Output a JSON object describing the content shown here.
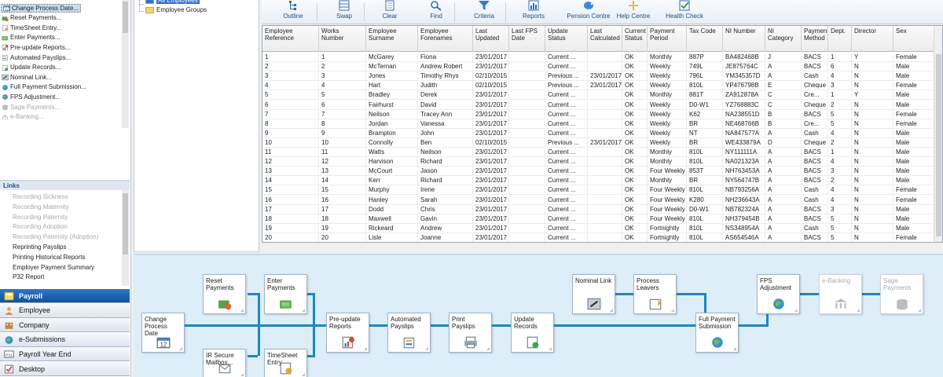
{
  "tasks": [
    {
      "label": "Change Process Date...",
      "icon": "calendar-icon",
      "selected": true,
      "enabled": true
    },
    {
      "label": "Reset Payments...",
      "icon": "reset-icon",
      "selected": false,
      "enabled": true
    },
    {
      "label": "TimeSheet Entry...",
      "icon": "timesheet-icon",
      "selected": false,
      "enabled": true
    },
    {
      "label": "Enter Payments...",
      "icon": "payments-icon",
      "selected": false,
      "enabled": true
    },
    {
      "label": "Pre-update Reports...",
      "icon": "report-icon",
      "selected": false,
      "enabled": true
    },
    {
      "label": "Automated Payslips...",
      "icon": "payslip-icon",
      "selected": false,
      "enabled": true
    },
    {
      "label": "Update Records...",
      "icon": "update-icon",
      "selected": false,
      "enabled": true
    },
    {
      "label": "Nominal Link...",
      "icon": "nominal-icon",
      "selected": false,
      "enabled": true
    },
    {
      "label": "Full Payment Submission...",
      "icon": "globe-icon",
      "selected": false,
      "enabled": true
    },
    {
      "label": "FPS Adjustment...",
      "icon": "globe-icon",
      "selected": false,
      "enabled": true
    },
    {
      "label": "Sage Payments...",
      "icon": "sage-icon",
      "selected": false,
      "enabled": false
    },
    {
      "label": "e-Banking...",
      "icon": "bank-icon",
      "selected": false,
      "enabled": false
    }
  ],
  "links": {
    "title": "Links",
    "items": [
      {
        "label": "Recording Sickness",
        "enabled": false
      },
      {
        "label": "Recording Maternity",
        "enabled": false
      },
      {
        "label": "Recording Paternity",
        "enabled": false
      },
      {
        "label": "Recording Adoption",
        "enabled": false
      },
      {
        "label": "Recording Paternity (Adoption)",
        "enabled": false
      },
      {
        "label": "Reprinting Payslips",
        "enabled": true
      },
      {
        "label": "Printing Historical Reports",
        "enabled": true
      },
      {
        "label": "Employer Payment Summary",
        "enabled": true
      },
      {
        "label": "P32 Report",
        "enabled": true
      }
    ]
  },
  "nav": [
    {
      "label": "Payroll",
      "icon": "payroll-icon",
      "active": true
    },
    {
      "label": "Employee",
      "icon": "employee-icon",
      "active": false
    },
    {
      "label": "Company",
      "icon": "company-icon",
      "active": false
    },
    {
      "label": "e-Submissions",
      "icon": "globe-icon",
      "active": false
    },
    {
      "label": "Payroll Year End",
      "icon": "year-end-icon",
      "active": false
    },
    {
      "label": "Desktop",
      "icon": "desktop-icon",
      "active": false
    }
  ],
  "tree": {
    "items": [
      {
        "label": "All Employees",
        "selected": true
      },
      {
        "label": "Employee Groups",
        "selected": false
      }
    ]
  },
  "toolbar": {
    "buttons": [
      {
        "label": "Outline",
        "icon": "outline-icon"
      },
      {
        "label": "Swap",
        "icon": "swap-icon"
      },
      {
        "label": "Clear",
        "icon": "clear-icon"
      },
      {
        "label": "Find",
        "icon": "find-icon"
      },
      {
        "label": "Criteria",
        "icon": "criteria-icon"
      },
      {
        "label": "Reports",
        "icon": "reports-icon"
      },
      {
        "label": "Pension Centre",
        "icon": "pension-icon"
      },
      {
        "label": "Help Centre",
        "icon": "help-icon"
      },
      {
        "label": "Health Check",
        "icon": "health-check-icon"
      }
    ]
  },
  "grid": {
    "columns": [
      "Employee Reference",
      "Works Number",
      "Employee Surname",
      "Employee Forenames",
      "Last Updated",
      "Last FPS Date",
      "Update Status",
      "Last Calculated",
      "Current Status",
      "Payment Period",
      "Tax Code",
      "NI Number",
      "NI Category",
      "Payment Method",
      "Dept.",
      "Director",
      "Sex"
    ],
    "rows": [
      [
        "1",
        "1",
        "McGarey",
        "Fiona",
        "23/01/2017",
        "",
        "Current ...",
        "",
        "OK",
        "Monthly",
        "887P",
        "BA482468B",
        "J",
        "BACS",
        "1",
        "Y",
        "Female"
      ],
      [
        "2",
        "2",
        "McTernan",
        "Andrew Robert",
        "23/01/2017",
        "",
        "Current ...",
        "",
        "OK",
        "Weekly",
        "749L",
        "JE875764C",
        "A",
        "BACS",
        "6",
        "N",
        "Male"
      ],
      [
        "3",
        "3",
        "Jones",
        "Timothy Rhys",
        "02/10/2015",
        "",
        "Previous ...",
        "23/01/2017",
        "OK",
        "Weekly",
        "796L",
        "YM345357D",
        "A",
        "Cash",
        "4",
        "N",
        "Male"
      ],
      [
        "4",
        "4",
        "Hart",
        "Judith",
        "02/10/2015",
        "",
        "Previous ...",
        "23/01/2017",
        "OK",
        "Weekly",
        "810L",
        "YP476798B",
        "E",
        "Cheque",
        "3",
        "N",
        "Female"
      ],
      [
        "5",
        "5",
        "Bradley",
        "Derek",
        "23/01/2017",
        "",
        "Current ...",
        "",
        "OK",
        "Monthly",
        "881T",
        "ZA912878A",
        "C",
        "Cre...",
        "1",
        "Y",
        "Male"
      ],
      [
        "6",
        "6",
        "Fairhurst",
        "David",
        "23/01/2017",
        "",
        "Current ...",
        "",
        "OK",
        "Weekly",
        "D0-W1",
        "YZ768883C",
        "C",
        "Cheque",
        "2",
        "N",
        "Male"
      ],
      [
        "7",
        "7",
        "Neilson",
        "Tracey Ann",
        "23/01/2017",
        "",
        "Current ...",
        "",
        "OK",
        "Weekly",
        "K62",
        "NA238551D",
        "B",
        "BACS",
        "5",
        "N",
        "Female"
      ],
      [
        "8",
        "8",
        "Jordan",
        "Vanessa",
        "23/01/2017",
        "",
        "Current ...",
        "",
        "OK",
        "Weekly",
        "BR",
        "NE468766B",
        "B",
        "Cre...",
        "5",
        "N",
        "Female"
      ],
      [
        "9",
        "9",
        "Brampton",
        "John",
        "23/01/2017",
        "",
        "Current ...",
        "",
        "OK",
        "Weekly",
        "NT",
        "NA847577A",
        "A",
        "Cash",
        "4",
        "N",
        "Male"
      ],
      [
        "10",
        "10",
        "Connolly",
        "Ben",
        "02/10/2015",
        "",
        "Previous ...",
        "23/01/2017",
        "OK",
        "Weekly",
        "BR",
        "WE433879A",
        "D",
        "Cheque",
        "2",
        "N",
        "Male"
      ],
      [
        "11",
        "11",
        "Watts",
        "Neilson",
        "23/01/2017",
        "",
        "Current ...",
        "",
        "OK",
        "Monthly",
        "810L",
        "NY111111A",
        "A",
        "BACS",
        "1",
        "N",
        "Male"
      ],
      [
        "12",
        "12",
        "Harvison",
        "Richard",
        "23/01/2017",
        "",
        "Current ...",
        "",
        "OK",
        "Monthly",
        "810L",
        "NA021323A",
        "A",
        "BACS",
        "4",
        "N",
        "Male"
      ],
      [
        "13",
        "13",
        "McCourt",
        "Jason",
        "23/01/2017",
        "",
        "Current ...",
        "",
        "OK",
        "Four Weekly",
        "853T",
        "NH763453A",
        "A",
        "BACS",
        "3",
        "N",
        "Male"
      ],
      [
        "14",
        "14",
        "Kerr",
        "Richard",
        "23/01/2017",
        "",
        "Current ...",
        "",
        "OK",
        "Monthly",
        "BR",
        "NY564747B",
        "A",
        "BACS",
        "2",
        "N",
        "Male"
      ],
      [
        "15",
        "15",
        "Murphy",
        "Irene",
        "23/01/2017",
        "",
        "Current ...",
        "",
        "OK",
        "Four Weekly",
        "810L",
        "NB793256A",
        "A",
        "Cash",
        "4",
        "N",
        "Female"
      ],
      [
        "16",
        "16",
        "Hanley",
        "Sarah",
        "23/01/2017",
        "",
        "Current ...",
        "",
        "OK",
        "Four Weekly",
        "K280",
        "NH236643A",
        "A",
        "Cash",
        "4",
        "N",
        "Female"
      ],
      [
        "17",
        "17",
        "Dodd",
        "Chris",
        "23/01/2017",
        "",
        "Current ...",
        "",
        "OK",
        "Four Weekly",
        "D0-W1",
        "NB782324A",
        "A",
        "BACS",
        "3",
        "N",
        "Male"
      ],
      [
        "18",
        "18",
        "Maxwell",
        "Gavin",
        "23/01/2017",
        "",
        "Current ...",
        "",
        "OK",
        "Four Weekly",
        "810L",
        "NH379454B",
        "A",
        "BACS",
        "5",
        "N",
        "Male"
      ],
      [
        "19",
        "19",
        "Rickeard",
        "Andrew",
        "23/01/2017",
        "",
        "Current ...",
        "",
        "OK",
        "Fortnightly",
        "810L",
        "NS348954A",
        "A",
        "Cash",
        "5",
        "N",
        "Male"
      ],
      [
        "20",
        "20",
        "Lisle",
        "Joanne",
        "23/01/2017",
        "",
        "Current ...",
        "",
        "OK",
        "Fortnightly",
        "810L",
        "AS654546A",
        "A",
        "BACS",
        "5",
        "N",
        "Female"
      ]
    ]
  },
  "process_map": {
    "steps": [
      {
        "label": "Change Process Date",
        "icon": "calendar-icon",
        "enabled": true
      },
      {
        "label": "Reset Payments",
        "icon": "reset-icon",
        "enabled": true
      },
      {
        "label": "IR Secure Mailbox...",
        "icon": "mailbox-icon",
        "enabled": true
      },
      {
        "label": "Enter Payments",
        "icon": "payments-icon",
        "enabled": true
      },
      {
        "label": "TimeSheet Entry",
        "icon": "timesheet-icon",
        "enabled": true
      },
      {
        "label": "Pre-update Reports",
        "icon": "report-icon",
        "enabled": true
      },
      {
        "label": "Automated Payslips",
        "icon": "payslip-icon",
        "enabled": true
      },
      {
        "label": "Print Payslips",
        "icon": "print-icon",
        "enabled": true
      },
      {
        "label": "Update Records",
        "icon": "update-icon",
        "enabled": true
      },
      {
        "label": "Nominal Link",
        "icon": "nominal-icon",
        "enabled": true
      },
      {
        "label": "Process Leavers",
        "icon": "leavers-icon",
        "enabled": true
      },
      {
        "label": "Full Payment Submission",
        "icon": "globe-icon",
        "enabled": true
      },
      {
        "label": "FPS Adjustment",
        "icon": "globe-icon",
        "enabled": true
      },
      {
        "label": "e-Banking",
        "icon": "bank-icon",
        "enabled": false
      },
      {
        "label": "Sage Payments",
        "icon": "sage-icon",
        "enabled": false
      }
    ]
  },
  "colors": {
    "accent": "#1a89c0",
    "nav_active": "#1f63b0",
    "map_background": "#ddeef8"
  }
}
